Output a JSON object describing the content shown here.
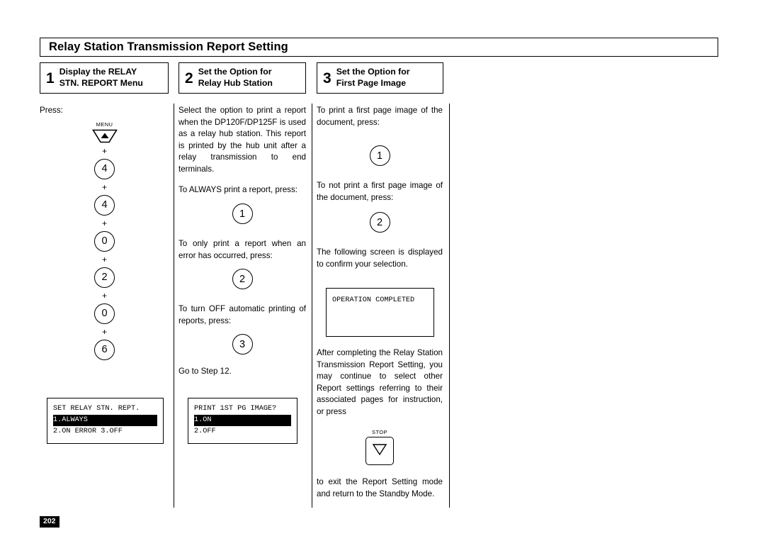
{
  "title": "Relay Station Transmission Report Setting",
  "page_number": "202",
  "steps": [
    {
      "number": "1",
      "label_line1": "Display the RELAY",
      "label_line2": "STN. REPORT Menu"
    },
    {
      "number": "2",
      "label_line1": "Set the Option for",
      "label_line2": "Relay Hub Station"
    },
    {
      "number": "3",
      "label_line1": "Set the Option for",
      "label_line2": "First Page Image"
    }
  ],
  "column1": {
    "intro": "Press:",
    "menu_key_caption": "MENU",
    "keys": [
      "4",
      "4",
      "0",
      "2",
      "0",
      "6"
    ],
    "plus": "+",
    "lcd": {
      "line1": "SET RELAY STN. REPT.",
      "line2": "1.ALWAYS",
      "line3": "2.ON ERROR",
      "line4": "3.OFF"
    }
  },
  "column2": {
    "para1": "Select the option to print a report when the DP120F/DP125F is used as a relay hub station. This report is printed by the hub unit after a relay transmission to end terminals.",
    "para2": "To ALWAYS print a report, press:",
    "key1": "1",
    "para3": "To only print a report when an error has occurred, press:",
    "key2": "2",
    "para4": "To turn OFF automatic printing of reports, press:",
    "key3": "3",
    "para5": "Go to Step 12.",
    "lcd": {
      "line1": "PRINT 1ST PG IMAGE?",
      "line2": "1.ON",
      "line3": "2.OFF"
    }
  },
  "column3": {
    "para1": "To print a first page image of the document, press:",
    "key1": "1",
    "para2": "To not print a first page image of the document, press:",
    "key2": "2",
    "para3": "The following screen is displayed to confirm your selection.",
    "lcd": {
      "line1": "OPERATION COMPLETED"
    },
    "para4": "After completing the Relay Station Transmission Report Setting, you may continue to select other Report settings referring to their associated pages for instruction, or press",
    "stop_key_caption": "STOP",
    "para5": "to exit the Report Setting mode and return to the Standby Mode."
  }
}
